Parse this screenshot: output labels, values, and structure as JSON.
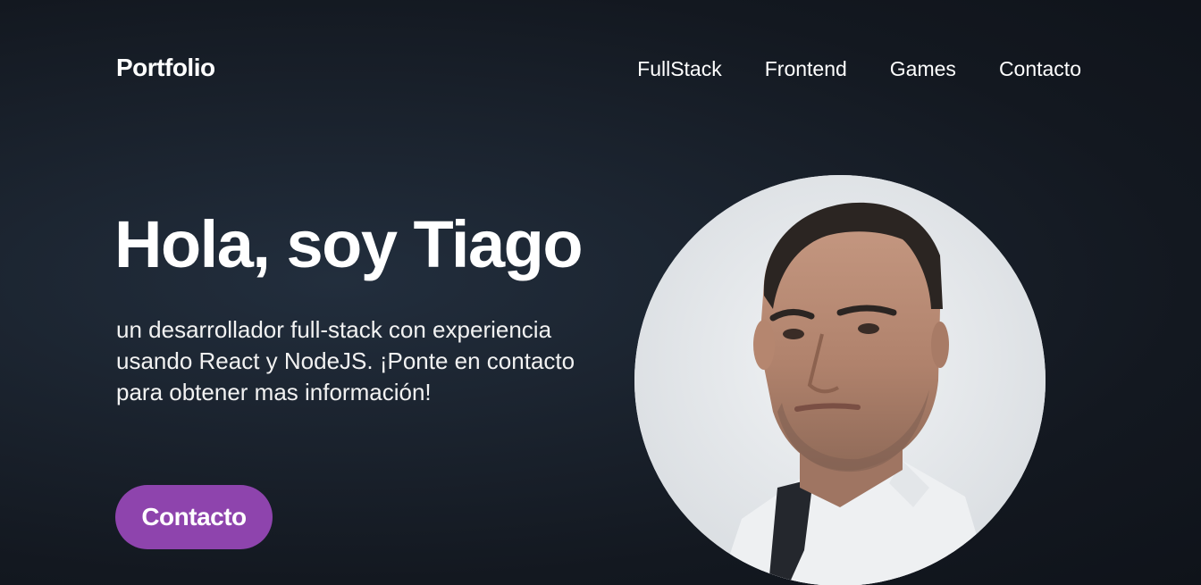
{
  "nav": {
    "brand": "Portfolio",
    "links": [
      {
        "label": "FullStack"
      },
      {
        "label": "Frontend"
      },
      {
        "label": "Games"
      },
      {
        "label": "Contacto"
      }
    ]
  },
  "hero": {
    "title": "Hola, soy Tiago",
    "description": "un desarrollador full-stack con experiencia usando React y NodeJS. ¡Ponte en contacto para obtener mas información!",
    "cta_label": "Contacto"
  },
  "colors": {
    "background": "#131820",
    "accent": "#8e44ad",
    "text": "#ffffff"
  },
  "avatar": {
    "icon": "profile-photo"
  }
}
